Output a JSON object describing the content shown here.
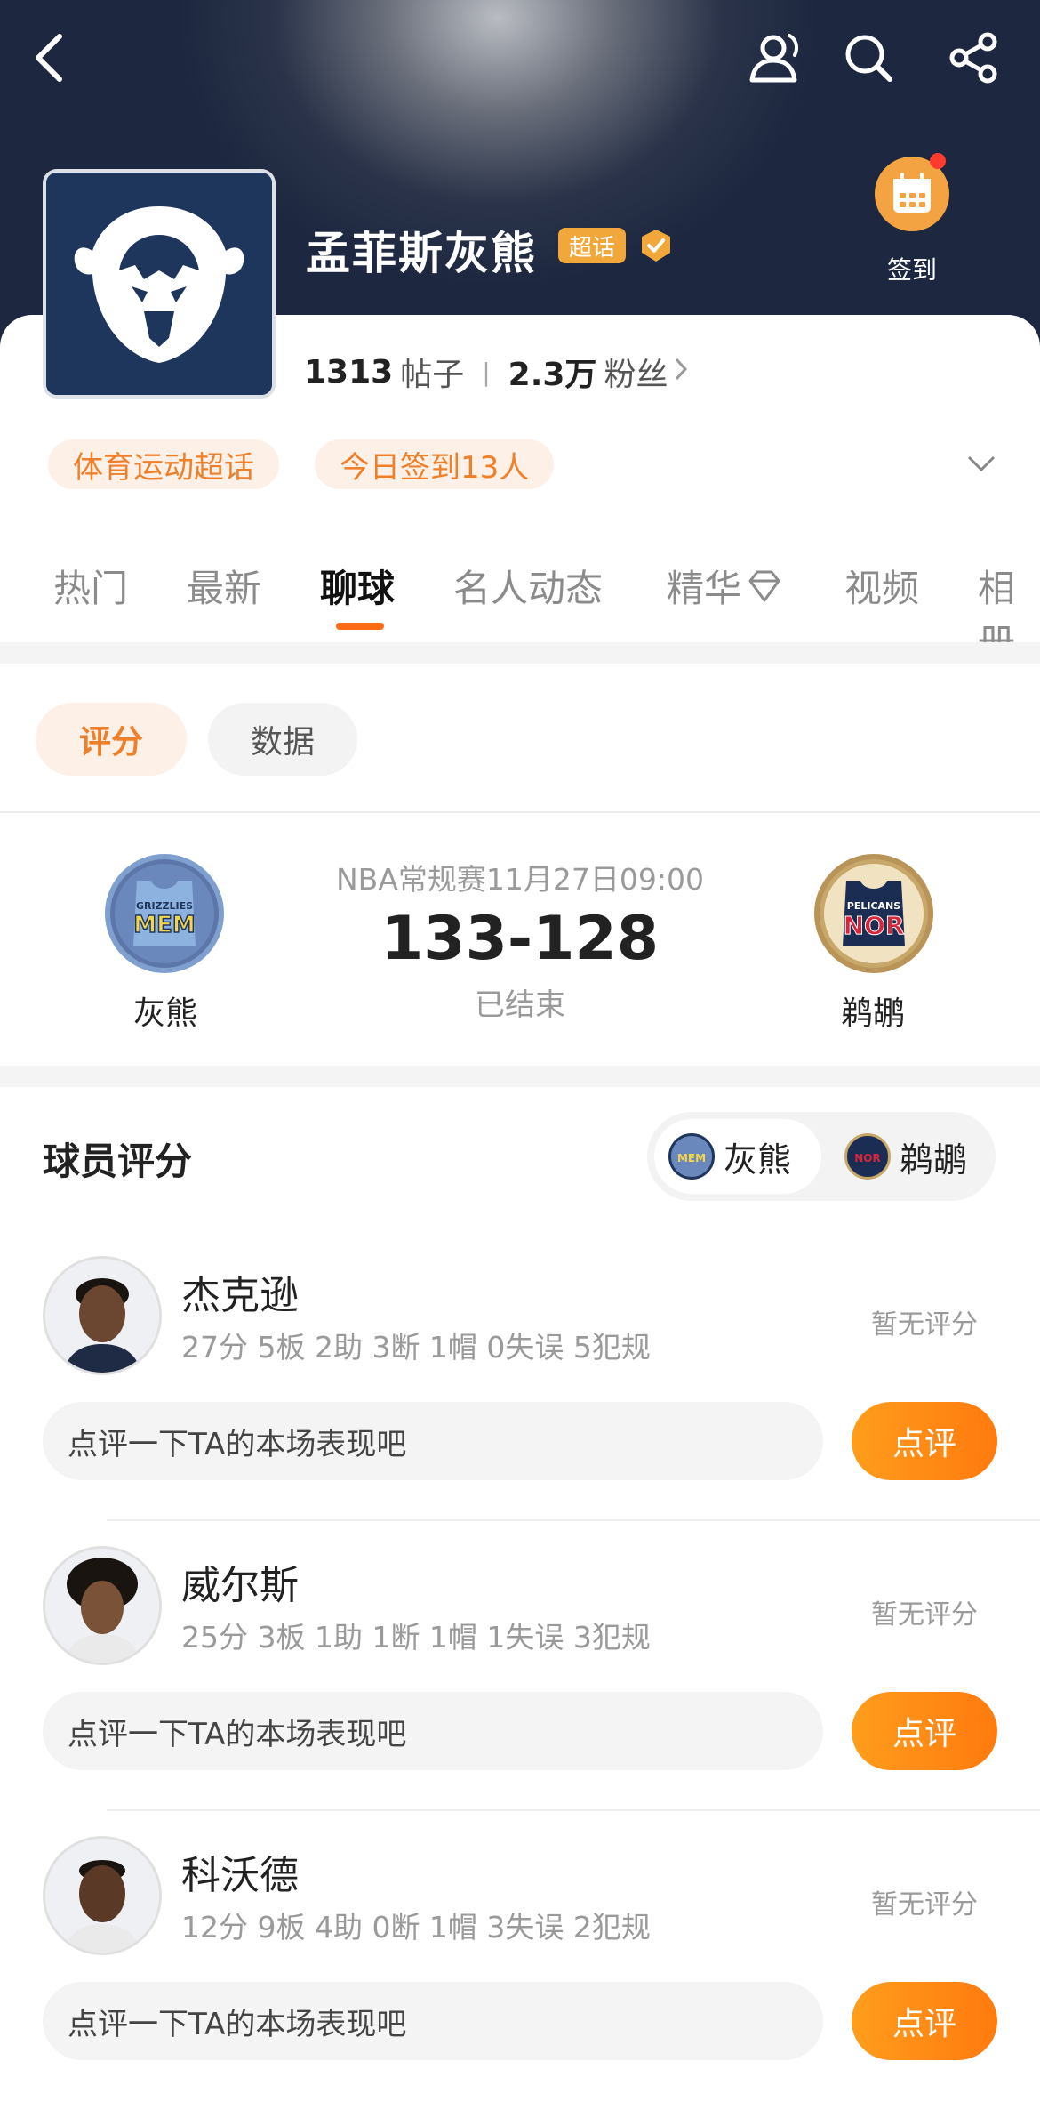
{
  "header": {
    "title": "孟菲斯灰熊",
    "super_tag": "超话",
    "checkin_label": "签到"
  },
  "stats": {
    "posts_count": "1313",
    "posts_label": "帖子",
    "fans_count": "2.3万",
    "fans_label": "粉丝"
  },
  "tags": [
    "体育运动超话",
    "今日签到13人"
  ],
  "tabs": [
    "热门",
    "最新",
    "聊球",
    "名人动态",
    "精华",
    "视频",
    "相册"
  ],
  "active_tab": "聊球",
  "segments": {
    "rating": "评分",
    "data": "数据"
  },
  "match": {
    "title": "NBA常规赛11月27日09:00",
    "score": "133-128",
    "status": "已结束",
    "home": {
      "name": "灰熊",
      "logo_text": "MEM",
      "logo_small": "GRIZZLIES"
    },
    "away": {
      "name": "鹈鹕",
      "logo_text": "NOR",
      "logo_small": "PELICANS"
    }
  },
  "player_section": {
    "title": "球员评分",
    "switch": [
      "灰熊",
      "鹈鹕"
    ]
  },
  "players": [
    {
      "name": "杰克逊",
      "stats": "27分 5板 2助 3断 1帽 0失误 5犯规",
      "score": "暂无评分",
      "placeholder": "点评一下TA的本场表现吧",
      "button": "点评"
    },
    {
      "name": "威尔斯",
      "stats": "25分 3板 1助 1断 1帽 1失误 3犯规",
      "score": "暂无评分",
      "placeholder": "点评一下TA的本场表现吧",
      "button": "点评"
    },
    {
      "name": "科沃德",
      "stats": "12分 9板 4助 0断 1帽 3失误 2犯规",
      "score": "暂无评分",
      "placeholder": "点评一下TA的本场表现吧",
      "button": "点评"
    }
  ],
  "colors": {
    "accent": "#ff7a0e",
    "accent_soft": "#fdf0e6",
    "header_dark": "#1d2840"
  }
}
